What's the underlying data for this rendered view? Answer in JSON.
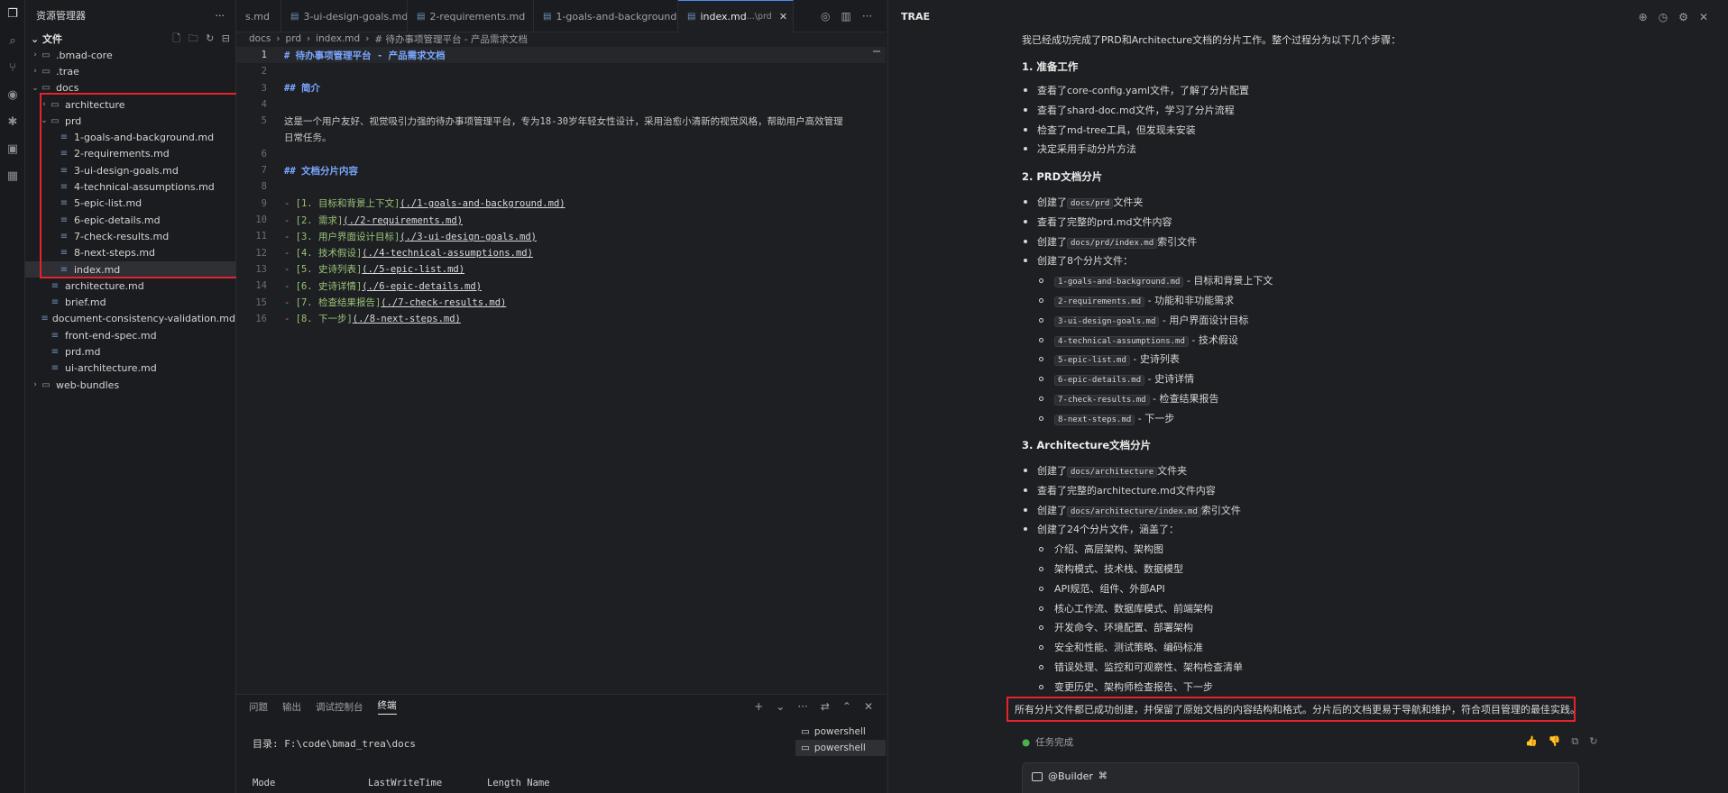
{
  "activity_bar": {
    "icons": [
      "files-icon",
      "search-icon",
      "source-control-icon",
      "eye-icon",
      "debug-icon",
      "remote-icon",
      "extensions-icon"
    ]
  },
  "explorer": {
    "header": "资源管理器",
    "section": "文件",
    "tree": [
      {
        "label": ".bmad-core",
        "type": "folder",
        "depth": 0,
        "expanded": false
      },
      {
        "label": ".trae",
        "type": "folder",
        "depth": 0,
        "expanded": false
      },
      {
        "label": "docs",
        "type": "folder",
        "depth": 0,
        "expanded": true
      },
      {
        "label": "architecture",
        "type": "folder",
        "depth": 1,
        "expanded": false
      },
      {
        "label": "prd",
        "type": "folder",
        "depth": 1,
        "expanded": true
      },
      {
        "label": "1-goals-and-background.md",
        "type": "file",
        "depth": 2
      },
      {
        "label": "2-requirements.md",
        "type": "file",
        "depth": 2
      },
      {
        "label": "3-ui-design-goals.md",
        "type": "file",
        "depth": 2
      },
      {
        "label": "4-technical-assumptions.md",
        "type": "file",
        "depth": 2
      },
      {
        "label": "5-epic-list.md",
        "type": "file",
        "depth": 2
      },
      {
        "label": "6-epic-details.md",
        "type": "file",
        "depth": 2
      },
      {
        "label": "7-check-results.md",
        "type": "file",
        "depth": 2
      },
      {
        "label": "8-next-steps.md",
        "type": "file",
        "depth": 2
      },
      {
        "label": "index.md",
        "type": "file",
        "depth": 2,
        "selected": true
      },
      {
        "label": "architecture.md",
        "type": "file",
        "depth": 1
      },
      {
        "label": "brief.md",
        "type": "file",
        "depth": 1
      },
      {
        "label": "document-consistency-validation.md",
        "type": "file",
        "depth": 1
      },
      {
        "label": "front-end-spec.md",
        "type": "file",
        "depth": 1
      },
      {
        "label": "prd.md",
        "type": "file",
        "depth": 1
      },
      {
        "label": "ui-architecture.md",
        "type": "file",
        "depth": 1
      },
      {
        "label": "web-bundles",
        "type": "folder",
        "depth": 0,
        "expanded": false
      }
    ]
  },
  "tabs": [
    {
      "label": "s.md",
      "active": false
    },
    {
      "label": "3-ui-design-goals.md",
      "active": false
    },
    {
      "label": "2-requirements.md",
      "active": false
    },
    {
      "label": "1-goals-and-background.md",
      "active": false
    },
    {
      "label": "index.md",
      "suffix": "...\\prd",
      "active": true
    }
  ],
  "breadcrumb": [
    "docs",
    "prd",
    "index.md",
    "# 待办事项管理平台 - 产品需求文档"
  ],
  "editor": {
    "lines": [
      {
        "n": "1",
        "kind": "h",
        "text": "# 待办事项管理平台 - 产品需求文档"
      },
      {
        "n": "2",
        "kind": "blank",
        "text": ""
      },
      {
        "n": "3",
        "kind": "h",
        "text": "## 简介"
      },
      {
        "n": "4",
        "kind": "blank",
        "text": ""
      },
      {
        "n": "5",
        "kind": "txt",
        "text": "这是一个用户友好、视觉吸引力强的待办事项管理平台，专为18-30岁年轻女性设计，采用治愈小清新的视觉风格，帮助用户高效管理"
      },
      {
        "n": "",
        "kind": "txt",
        "text": "日常任务。"
      },
      {
        "n": "6",
        "kind": "blank",
        "text": ""
      },
      {
        "n": "7",
        "kind": "h",
        "text": "## 文档分片内容"
      },
      {
        "n": "8",
        "kind": "blank",
        "text": ""
      },
      {
        "n": "9",
        "kind": "link",
        "label": "[1. 目标和背景上下文]",
        "url": "(./1-goals-and-background.md)"
      },
      {
        "n": "10",
        "kind": "link",
        "label": "[2. 需求]",
        "url": "(./2-requirements.md)"
      },
      {
        "n": "11",
        "kind": "link",
        "label": "[3. 用户界面设计目标]",
        "url": "(./3-ui-design-goals.md)"
      },
      {
        "n": "12",
        "kind": "link",
        "label": "[4. 技术假设]",
        "url": "(./4-technical-assumptions.md)"
      },
      {
        "n": "13",
        "kind": "link",
        "label": "[5. 史诗列表]",
        "url": "(./5-epic-list.md)"
      },
      {
        "n": "14",
        "kind": "link",
        "label": "[6. 史诗详情]",
        "url": "(./6-epic-details.md)"
      },
      {
        "n": "15",
        "kind": "link",
        "label": "[7. 检查结果报告]",
        "url": "(./7-check-results.md)"
      },
      {
        "n": "16",
        "kind": "link",
        "label": "[8. 下一步]",
        "url": "(./8-next-steps.md)"
      }
    ]
  },
  "panel": {
    "tabs": [
      "问题",
      "输出",
      "调试控制台",
      "终端"
    ],
    "active_tab": "终端",
    "terminal_line1": "目录: F:\\code\\bmad_trea\\docs",
    "terminal_headers": [
      "Mode",
      "LastWriteTime",
      "Length Name"
    ],
    "shells": [
      "powershell",
      "powershell"
    ]
  },
  "chat": {
    "title": "TRAE",
    "intro": "我已经成功完成了PRD和Architecture文档的分片工作。整个过程分为以下几个步骤：",
    "sections": [
      {
        "heading": "1. 准备工作"
      },
      {
        "heading": "2. PRD文档分片"
      },
      {
        "heading": "3. Architecture文档分片"
      }
    ],
    "s1_items": [
      "查看了core-config.yaml文件，了解了分片配置",
      "查看了shard-doc.md文件，学习了分片流程",
      "检查了md-tree工具，但发现未安装",
      "决定采用手动分片方法"
    ],
    "s2": {
      "a_pre": "创建了",
      "a_code": "docs/prd",
      "a_post": "文件夹",
      "b": "查看了完整的prd.md文件内容",
      "c_pre": "创建了",
      "c_code": "docs/prd/index.md",
      "c_post": "索引文件",
      "d": "创建了8个分片文件：",
      "files": [
        {
          "code": "1-goals-and-background.md",
          "desc": " - 目标和背景上下文"
        },
        {
          "code": "2-requirements.md",
          "desc": " - 功能和非功能需求"
        },
        {
          "code": "3-ui-design-goals.md",
          "desc": " - 用户界面设计目标"
        },
        {
          "code": "4-technical-assumptions.md",
          "desc": " - 技术假设"
        },
        {
          "code": "5-epic-list.md",
          "desc": " - 史诗列表"
        },
        {
          "code": "6-epic-details.md",
          "desc": " - 史诗详情"
        },
        {
          "code": "7-check-results.md",
          "desc": " - 检查结果报告"
        },
        {
          "code": "8-next-steps.md",
          "desc": " - 下一步"
        }
      ]
    },
    "s3": {
      "a_pre": "创建了",
      "a_code": "docs/architecture",
      "a_post": "文件夹",
      "b": "查看了完整的architecture.md文件内容",
      "c_pre": "创建了",
      "c_code": "docs/architecture/index.md",
      "c_post": "索引文件",
      "d": "创建了24个分片文件，涵盖了：",
      "subs": [
        "介绍、高层架构、架构图",
        "架构模式、技术栈、数据模型",
        "API规范、组件、外部API",
        "核心工作流、数据库模式、前端架构",
        "开发命令、环境配置、部署架构",
        "安全和性能、测试策略、编码标准",
        "错误处理、监控和可观察性、架构检查清单",
        "变更历史、架构师检查报告、下一步"
      ]
    },
    "summary": "所有分片文件都已成功创建，并保留了原始文档的内容结构和格式。分片后的文档更易于导航和维护，符合项目管理的最佳实践。",
    "done_label": "任务完成",
    "input_mention": "@Builder"
  }
}
